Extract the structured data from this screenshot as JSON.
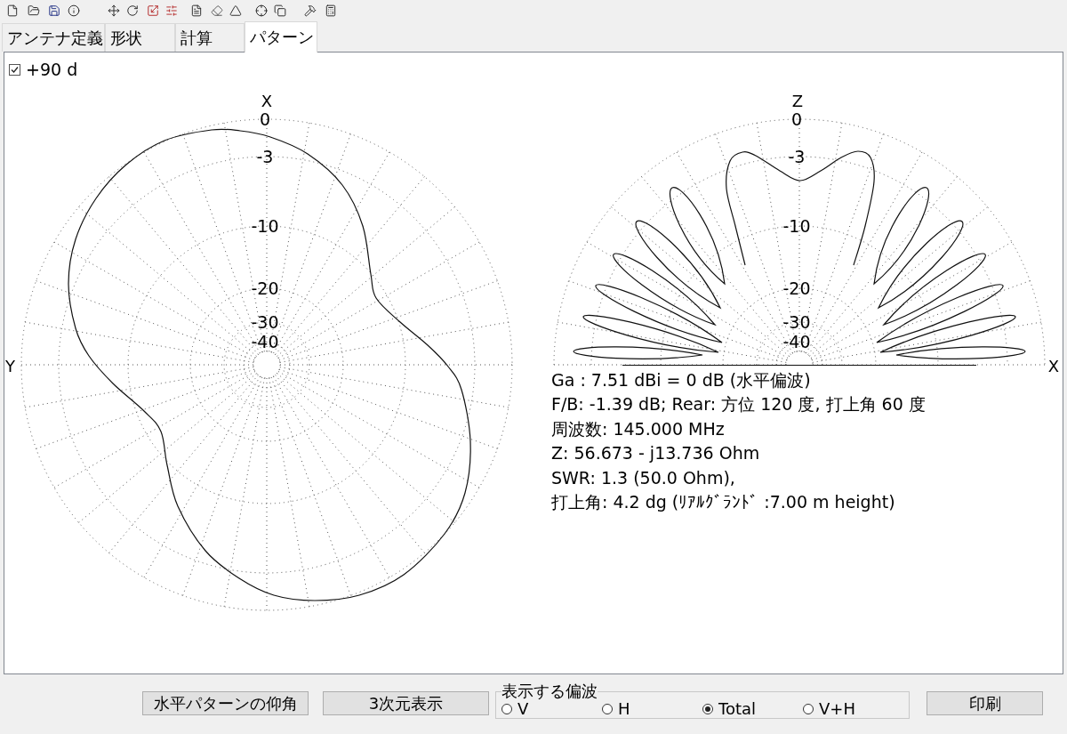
{
  "tabs": [
    {
      "label": "アンテナ定義",
      "selected": false
    },
    {
      "label": "形状",
      "selected": false
    },
    {
      "label": "計算",
      "selected": false
    },
    {
      "label": "パターン",
      "selected": true
    }
  ],
  "pattern_view": {
    "option": {
      "label": "+90 d",
      "checked": true
    },
    "azimuth_plot": {
      "top_axis": "X",
      "left_axis": "Y",
      "ring_labels": [
        "0",
        "-3",
        "-10",
        "-20",
        "-30",
        "-40"
      ]
    },
    "elevation_plot": {
      "top_axis": "Z",
      "right_axis": "X",
      "ring_labels": [
        "0",
        "-3",
        "-10",
        "-20",
        "-30",
        "-40"
      ]
    },
    "results": [
      "Ga : 7.51 dBi = 0 dB (水平偏波)",
      "F/B: -1.39 dB; Rear: 方位 120 度, 打上角 60 度",
      "周波数: 145.000 MHz",
      "Z: 56.673 - j13.736 Ohm",
      "SWR: 1.3 (50.0 Ohm),",
      "打上角: 4.2 dg (ﾘｱﾙｸﾞﾗﾝﾄﾞ :7.00 m height)"
    ]
  },
  "footer": {
    "buttons": [
      "水平パターンの仰角",
      "3次元表示"
    ],
    "polarization": {
      "title": "表示する偏波",
      "options": [
        {
          "label": "V",
          "selected": false
        },
        {
          "label": "H",
          "selected": false
        },
        {
          "label": "Total",
          "selected": true
        },
        {
          "label": "V+H",
          "selected": false
        }
      ]
    },
    "print_button": "印刷"
  }
}
